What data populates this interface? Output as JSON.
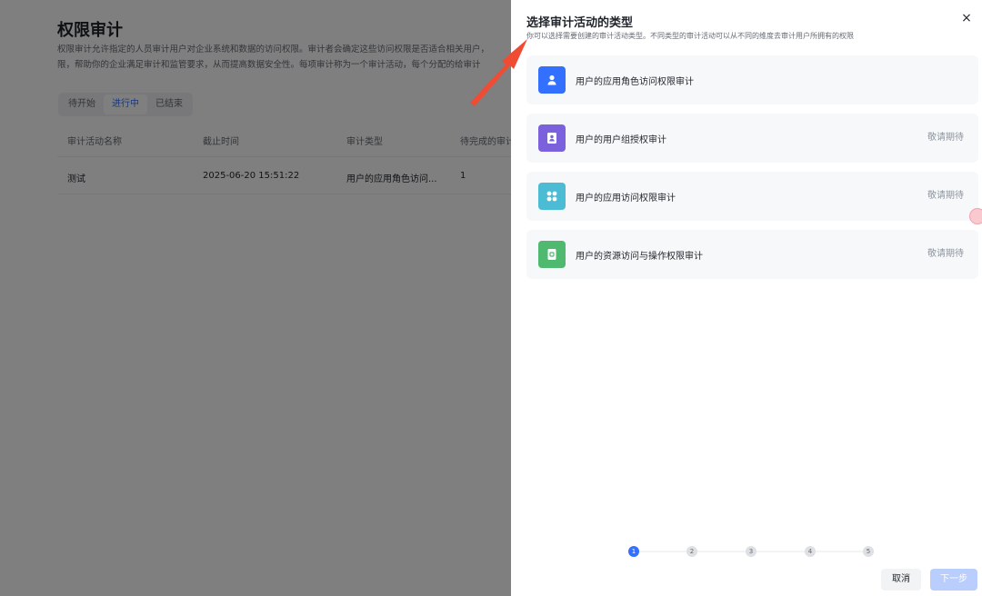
{
  "background": {
    "title": "权限审计",
    "desc_line1": "权限审计允许指定的人员审计用户对企业系统和数据的访问权限。审计者会确定这些访问权限是否适合相关用户，",
    "desc_line2": "限，帮助你的企业满足审计和监管要求，从而提高数据安全性。每项审计称为一个审计活动，每个分配的给审计",
    "tabs": [
      {
        "label": "待开始"
      },
      {
        "label": "进行中"
      },
      {
        "label": "已结束"
      }
    ],
    "columns": [
      "审计活动名称",
      "截止时间",
      "审计类型",
      "待完成的审计"
    ],
    "rows": [
      {
        "name": "测试",
        "deadline": "2025-06-20 15:51:22",
        "type": "用户的应用角色访问...",
        "pending": "1"
      }
    ]
  },
  "drawer": {
    "title": "选择审计活动的类型",
    "subtitle": "你可以选择需要创建的审计活动类型。不同类型的审计活动可以从不同的维度去审计用户所拥有的权限",
    "close_icon": "×",
    "cards": [
      {
        "label": "用户的应用角色访问权限审计",
        "status": "",
        "icon": "user-icon",
        "color": "#3370ff"
      },
      {
        "label": "用户的用户组授权审计",
        "status": "敬请期待",
        "icon": "user-card-icon",
        "color": "#7b61dc"
      },
      {
        "label": "用户的应用访问权限审计",
        "status": "敬请期待",
        "icon": "apps-icon",
        "color": "#4cbcd4"
      },
      {
        "label": "用户的资源访问与操作权限审计",
        "status": "敬请期待",
        "icon": "document-icon",
        "color": "#4fb970"
      }
    ],
    "steps": [
      "1",
      "2",
      "3",
      "4",
      "5"
    ],
    "current_step": 1,
    "cancel_label": "取消",
    "next_label": "下一步"
  }
}
